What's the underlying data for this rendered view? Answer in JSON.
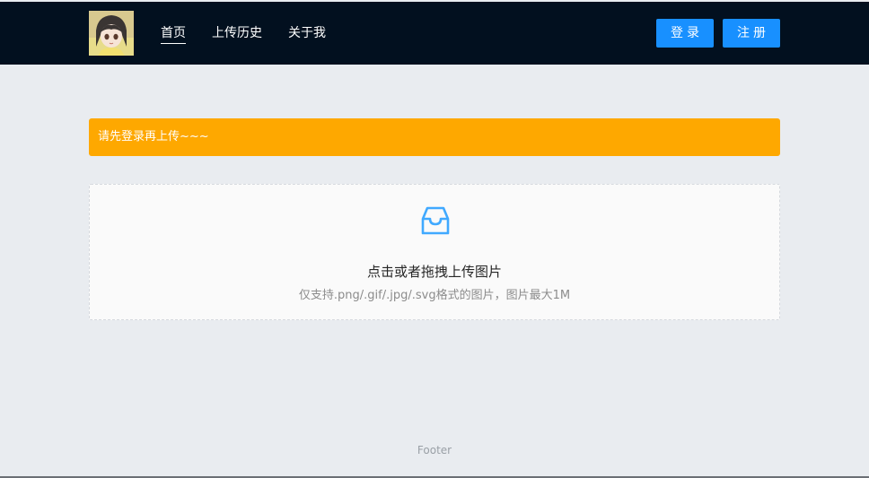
{
  "header": {
    "nav": [
      {
        "label": "首页",
        "active": true
      },
      {
        "label": "上传历史",
        "active": false
      },
      {
        "label": "关于我",
        "active": false
      }
    ],
    "login_label": "登录",
    "register_label": "注册"
  },
  "alert": {
    "text": "请先登录再上传~~~",
    "color": "#fea800"
  },
  "upload": {
    "icon": "inbox-icon",
    "text": "点击或者拖拽上传图片",
    "hint": "仅支持.png/.gif/.jpg/.svg格式的图片，图片最大1M"
  },
  "footer": {
    "text": "Footer"
  },
  "colors": {
    "header_bg": "#02101f",
    "primary": "#1890ff",
    "page_bg": "#e9ecf0"
  }
}
